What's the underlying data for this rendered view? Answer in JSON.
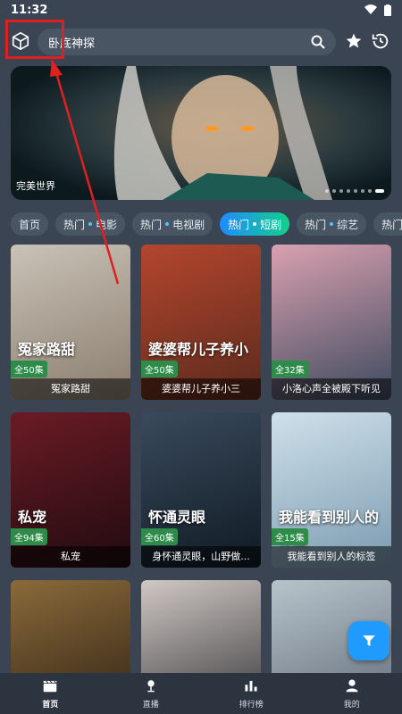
{
  "status": {
    "time": "11:32"
  },
  "search": {
    "placeholder": "卧底神探"
  },
  "banner": {
    "title": "完美世界",
    "dots_total": 8,
    "dot_active": 8
  },
  "chips": [
    {
      "label": "首页",
      "dot": false,
      "active": false
    },
    {
      "label": "热门",
      "dot": true,
      "sub": "电影",
      "active": false
    },
    {
      "label": "热门",
      "dot": true,
      "sub": "电视剧",
      "active": false
    },
    {
      "label": "热门",
      "dot": true,
      "sub": "短剧",
      "active": true
    },
    {
      "label": "热门",
      "dot": true,
      "sub": "综艺",
      "active": false
    },
    {
      "label": "热门",
      "dot": false,
      "active": false
    }
  ],
  "cards": [
    {
      "title": "冤家路甜",
      "episodes": "全50集",
      "poster_text": "冤家路甜",
      "bg": [
        "#c9c2b6",
        "#8a7d6e"
      ]
    },
    {
      "title": "婆婆帮儿子养小三",
      "episodes": "全50集",
      "poster_text": "婆婆帮儿子养小三",
      "bg": [
        "#b4462e",
        "#5a2a1c"
      ]
    },
    {
      "title": "小洛心声全被殿下听见",
      "episodes": "全32集",
      "poster_text": "",
      "bg": [
        "#d9a1b0",
        "#3d4a5e"
      ]
    },
    {
      "title": "私宠",
      "episodes": "全94集",
      "poster_text": "私宠",
      "bg": [
        "#6b1b24",
        "#1f0b10"
      ]
    },
    {
      "title": "身怀通灵眼，山野做...",
      "episodes": "全60集",
      "poster_text": "怀通灵眼",
      "bg": [
        "#3a4a5c",
        "#0f1a24"
      ]
    },
    {
      "title": "我能看到别人的标签",
      "episodes": "全15集",
      "poster_text": "我能看到别人的标签",
      "bg": [
        "#cfe0ea",
        "#7a9bb0"
      ]
    },
    {
      "title": "",
      "episodes": "",
      "poster_text": "",
      "bg": [
        "#8a6a3a",
        "#2a1e12"
      ]
    },
    {
      "title": "",
      "episodes": "",
      "poster_text": "",
      "bg": [
        "#d0c8c4",
        "#2a2a2e"
      ]
    },
    {
      "title": "",
      "episodes": "",
      "poster_text": "",
      "bg": [
        "#b8c4cc",
        "#5a6470"
      ]
    }
  ],
  "nav": [
    {
      "label": "首页",
      "icon": "clapperboard-icon",
      "active": true
    },
    {
      "label": "直播",
      "icon": "live-icon",
      "active": false
    },
    {
      "label": "排行榜",
      "icon": "ranking-icon",
      "active": false
    },
    {
      "label": "我的",
      "icon": "profile-icon",
      "active": false
    }
  ],
  "colors": {
    "accent": "#1f9bff",
    "episode_badge": "#2e8b4a",
    "annotation": "#e02020"
  }
}
